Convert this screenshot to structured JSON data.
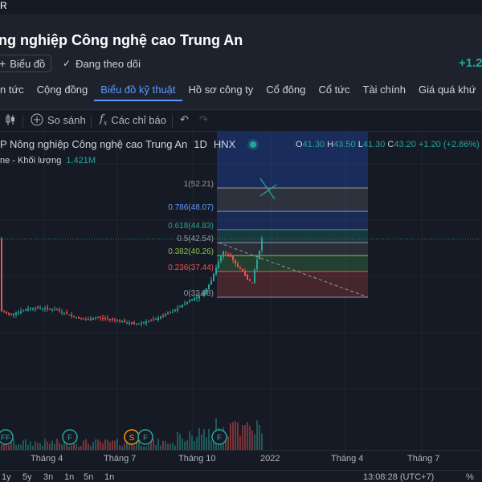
{
  "header": {
    "top_fragment": "R",
    "company_name": "ng nghiệp Công nghệ cao Trung An",
    "add_button_label": "Biểu đồ",
    "follow_label": "Đang theo dõi",
    "price_change": "+1.2"
  },
  "nav": {
    "tabs": [
      {
        "label": "n tức",
        "active": false
      },
      {
        "label": "Cộng đồng",
        "active": false
      },
      {
        "label": "Biểu đồ kỹ thuật",
        "active": true
      },
      {
        "label": "Hồ sơ công ty",
        "active": false
      },
      {
        "label": "Cổ đông",
        "active": false
      },
      {
        "label": "Cổ tức",
        "active": false
      },
      {
        "label": "Tài chính",
        "active": false
      },
      {
        "label": "Giá quá khứ",
        "active": false
      }
    ]
  },
  "toolbar": {
    "compare_label": "So sánh",
    "indicators_label": "Các chỉ báo",
    "fx_symbol": "f"
  },
  "legend": {
    "symbol_name": "P Nông nghiệp Công nghệ cao Trung An",
    "interval": "1D",
    "exchange": "HNX",
    "open_key": "O",
    "open": "41.30",
    "high_key": "H",
    "high": "43.50",
    "low_key": "L",
    "low": "41.30",
    "close_key": "C",
    "close": "43.20",
    "change": "+1.20 (+2.86%)",
    "volume_label": "ne - Khối lượng",
    "volume_value": "1.421M"
  },
  "chart_data": {
    "type": "candlestick",
    "fib_levels": [
      {
        "label": "1(52.21)",
        "ratio": 1,
        "price": 52.21,
        "color": "#9598a1"
      },
      {
        "label": "0.786(48.07)",
        "ratio": 0.786,
        "price": 48.07,
        "color": "#5c9bff"
      },
      {
        "label": "0.618(44.83)",
        "ratio": 0.618,
        "price": 44.83,
        "color": "#26a69a"
      },
      {
        "label": "0.5(42.54)",
        "ratio": 0.5,
        "price": 42.54,
        "color": "#9598a1"
      },
      {
        "label": "0.382(40.26)",
        "ratio": 0.382,
        "price": 40.26,
        "color": "#8bc34a"
      },
      {
        "label": "0.236(37.44)",
        "ratio": 0.236,
        "price": 37.44,
        "color": "#ef5350"
      },
      {
        "label": "0(32.88)",
        "ratio": 0,
        "price": 32.88,
        "color": "#9598a1"
      }
    ],
    "last_close": 43.2,
    "x_ticks": [
      "Tháng 4",
      "Tháng 7",
      "Tháng 10",
      "2022",
      "Tháng 4",
      "Tháng 7"
    ],
    "event_markers": [
      "FF",
      "F",
      "S",
      "F",
      "F"
    ]
  },
  "bottom": {
    "ranges": [
      "1y",
      "5y",
      "3n",
      "1n",
      "5n",
      "1n"
    ],
    "time": "13:08:28 (UTC+7)",
    "percent": "%"
  },
  "colors": {
    "up": "#26a69a",
    "down": "#ef5350",
    "accent": "#5c9bff"
  }
}
